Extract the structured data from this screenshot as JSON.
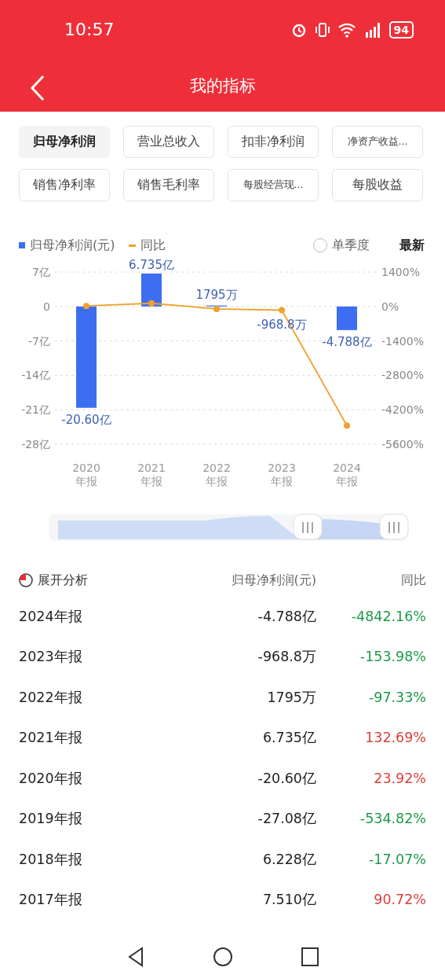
{
  "status_bar": {
    "time": "10:57",
    "battery": "94"
  },
  "header": {
    "title": "我的指标"
  },
  "chips": [
    {
      "label": "归母净利润",
      "selected": true
    },
    {
      "label": "营业总收入",
      "selected": false
    },
    {
      "label": "扣非净利润",
      "selected": false
    },
    {
      "label": "净资产收益...",
      "selected": false
    },
    {
      "label": "销售净利率",
      "selected": false
    },
    {
      "label": "销售毛利率",
      "selected": false
    },
    {
      "label": "每股经营现...",
      "selected": false
    },
    {
      "label": "每股收益",
      "selected": false
    }
  ],
  "legend": {
    "single_quarter": {
      "label": "单季度",
      "checked": false
    },
    "latest": "最新"
  },
  "chart": {
    "chart_data": {
      "type": "bar",
      "categories": [
        "2020\n年报",
        "2021\n年报",
        "2022\n年报",
        "2023\n年报",
        "2024\n年报"
      ],
      "series": [
        {
          "name": "归母净利润(元)",
          "type": "bar",
          "color": "#3d6ef2",
          "values": [
            -20.6,
            6.7,
            0.2,
            null,
            -4.8
          ]
        },
        {
          "name": "同比",
          "type": "line",
          "axis": "y2",
          "color": "#f0a12c",
          "marker": "circle",
          "values": [
            20,
            130,
            -100,
            -150,
            -4840
          ]
        }
      ],
      "ylim": [
        -28,
        7
      ],
      "y2lim": [
        -5600,
        1400
      ],
      "grid": true,
      "yticks": [
        {
          "value": 7,
          "label": "7亿"
        },
        {
          "value": 0,
          "label": "0"
        },
        {
          "value": -7,
          "label": "-7亿"
        },
        {
          "value": -14,
          "label": "-14亿"
        },
        {
          "value": -21,
          "label": "-21亿"
        },
        {
          "value": -28,
          "label": "-28亿"
        }
      ],
      "y2ticks": [
        {
          "value": 1400,
          "label": "1400%"
        },
        {
          "value": 0,
          "label": "0%"
        },
        {
          "value": -1400,
          "label": "-1400%"
        },
        {
          "value": -2800,
          "label": "-2800%"
        },
        {
          "value": -4200,
          "label": "-4200%"
        },
        {
          "value": -5600,
          "label": "-5600%"
        }
      ],
      "value_labels": [
        "-20.60亿",
        "6.735亿",
        "1795万",
        "-968.8万",
        "-4.788亿"
      ]
    }
  },
  "table": {
    "expand_label": "展开分析",
    "columns": [
      "归母净利润(元)",
      "同比"
    ],
    "rows": [
      {
        "period": "2024年报",
        "value": "-4.788亿",
        "yoy": "-4842.16%",
        "color": "#1f9a4a"
      },
      {
        "period": "2023年报",
        "value": "-968.8万",
        "yoy": "-153.98%",
        "color": "#1f9a4a"
      },
      {
        "period": "2022年报",
        "value": "1795万",
        "yoy": "-97.33%",
        "color": "#1f9a4a"
      },
      {
        "period": "2021年报",
        "value": "6.735亿",
        "yoy": "132.69%",
        "color": "#d9413c"
      },
      {
        "period": "2020年报",
        "value": "-20.60亿",
        "yoy": "23.92%",
        "color": "#d9413c"
      },
      {
        "period": "2019年报",
        "value": "-27.08亿",
        "yoy": "-534.82%",
        "color": "#1f9a4a"
      },
      {
        "period": "2018年报",
        "value": "6.228亿",
        "yoy": "-17.07%",
        "color": "#1f9a4a"
      },
      {
        "period": "2017年报",
        "value": "7.510亿",
        "yoy": "90.72%",
        "color": "#d9413c"
      }
    ]
  }
}
